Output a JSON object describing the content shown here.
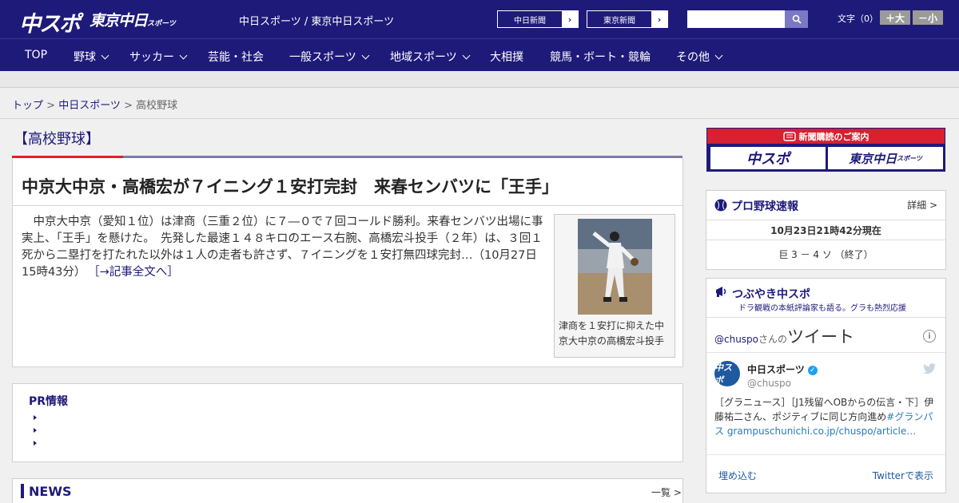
{
  "header": {
    "logo_main": "中スポ",
    "logo_tokyo": "東京中日",
    "logo_tokyo_sub": "スポーツ",
    "site_name": "中日スポーツ / 東京中日スポーツ",
    "ext_links": [
      {
        "label": "中日新聞"
      },
      {
        "label": "東京新聞"
      }
    ],
    "search_placeholder": "",
    "fontsize_label": "文字（0）",
    "fontsize_bigger": "＋大",
    "fontsize_smaller": "－小",
    "brand_color": "#1e1a7a"
  },
  "nav": {
    "items": [
      {
        "label": "TOP"
      },
      {
        "label": "野球"
      },
      {
        "label": "サッカー"
      },
      {
        "label": "芸能・社会"
      },
      {
        "label": "一般スポーツ"
      },
      {
        "label": "地域スポーツ"
      },
      {
        "label": "大相撲"
      },
      {
        "label": "競馬・ボート・競輪"
      },
      {
        "label": "その他"
      }
    ]
  },
  "breadcrumb": {
    "top": "トップ",
    "sep1": " > ",
    "parent": "中日スポーツ",
    "sep2": " > ",
    "current": "高校野球"
  },
  "section": {
    "title": "【高校野球】"
  },
  "article": {
    "headline": "中京大中京・高橋宏が７イニング１安打完封　来春センバツに「王手」",
    "body": "　中京大中京（愛知１位）は津商（三重２位）に７―０で７回コールド勝利。来春センバツ出場に事実上、「王手」を懸けた。　先発した最速１４８キロのエース右腕、高橋宏斗投手（２年）は、３回１死から二塁打を打たれた以外は１人の走者も許さず、７イニングを１安打無四球完封…（10月27日 15時43分）",
    "read_more": "［→記事全文へ］",
    "photo_caption": "津商を１安打に抑えた中京大中京の高橋宏斗投手"
  },
  "pr": {
    "title": "PR情報"
  },
  "news": {
    "title": "NEWS",
    "more": "一覧 >"
  },
  "sidebar": {
    "ad_banner": "新聞購読のご案内",
    "ad_logo_1": "中スポ",
    "ad_logo_2": "東京中日",
    "ad_logo_2_sub": "スポーツ",
    "baseball": {
      "title": "プロ野球速報",
      "detail": "詳細 >",
      "updated": "10月23日21時42分現在",
      "score": "巨 3 － 4 ソ （終了）"
    },
    "twitter": {
      "title": "つぶやき中スポ",
      "subtitle": "ドラ観戦の本紙評論家も語る。グラも熱烈応援",
      "handle": "@chuspo",
      "handle_suffix": "さんの",
      "tweets_label": "ツイート",
      "account_name": "中日スポーツ",
      "account_handle": "@chuspo",
      "avatar_text": "中スポ",
      "tweet_text": "［グラニュース］［J1残留へOBからの伝言・下］伊藤祐二さん、ポジティブに同じ方向進め",
      "tweet_link": "#グランパス grampuschunichi.co.jp/chuspo/article…",
      "embed": "埋め込む",
      "view_on_twitter": "Twitterで表示"
    }
  }
}
